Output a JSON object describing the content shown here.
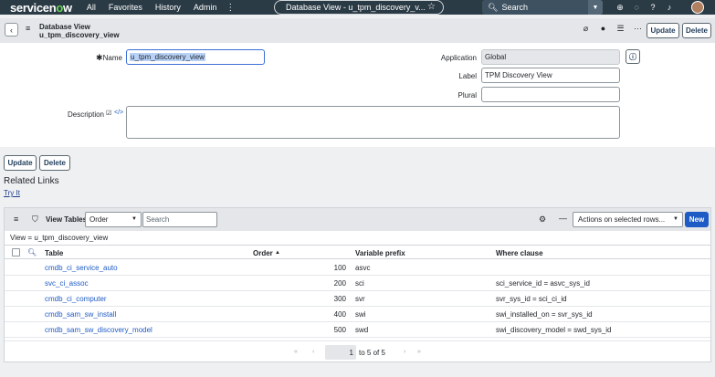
{
  "topnav": {
    "logo_pre": "servicen",
    "logo_o": "o",
    "logo_post": "w",
    "links": [
      "All",
      "Favorites",
      "History",
      "Admin"
    ],
    "context_title": "Database View - u_tpm_discovery_v...",
    "search_placeholder": "Search"
  },
  "form_header": {
    "title_line1": "Database View",
    "title_line2": "u_tpm_discovery_view",
    "update_label": "Update",
    "delete_label": "Delete"
  },
  "form": {
    "name_label": "Name",
    "name_value": "u_tpm_discovery_view",
    "application_label": "Application",
    "application_value": "Global",
    "label_label": "Label",
    "label_value": "TPM Discovery View",
    "plural_label": "Plural",
    "plural_value": "",
    "description_label": "Description",
    "description_value": ""
  },
  "bottom_buttons": {
    "update_label": "Update",
    "delete_label": "Delete"
  },
  "related_links": {
    "heading": "Related Links",
    "try_it": "Try It"
  },
  "view_tables": {
    "title": "View Tables",
    "filter_field": "Order",
    "search_placeholder": "Search",
    "actions_label": "Actions on selected rows...",
    "new_label": "New",
    "breadcrumb": "View = u_tpm_discovery_view",
    "columns": {
      "table": "Table",
      "order": "Order",
      "order_sort": "▲",
      "variable_prefix": "Variable prefix",
      "where_clause": "Where clause"
    },
    "rows": [
      {
        "table": "cmdb_ci_service_auto",
        "order": "100",
        "prefix": "asvc",
        "where": ""
      },
      {
        "table": "svc_ci_assoc",
        "order": "200",
        "prefix": "sci",
        "where": "sci_service_id = asvc_sys_id"
      },
      {
        "table": "cmdb_ci_computer",
        "order": "300",
        "prefix": "svr",
        "where": "svr_sys_id = sci_ci_id"
      },
      {
        "table": "cmdb_sam_sw_install",
        "order": "400",
        "prefix": "swi",
        "where": "swi_installed_on = svr_sys_id"
      },
      {
        "table": "cmdb_sam_sw_discovery_model",
        "order": "500",
        "prefix": "swd",
        "where": "swi_discovery_model = swd_sys_id"
      }
    ],
    "pager": {
      "current": "1",
      "range_text": "to 5 of 5"
    }
  }
}
